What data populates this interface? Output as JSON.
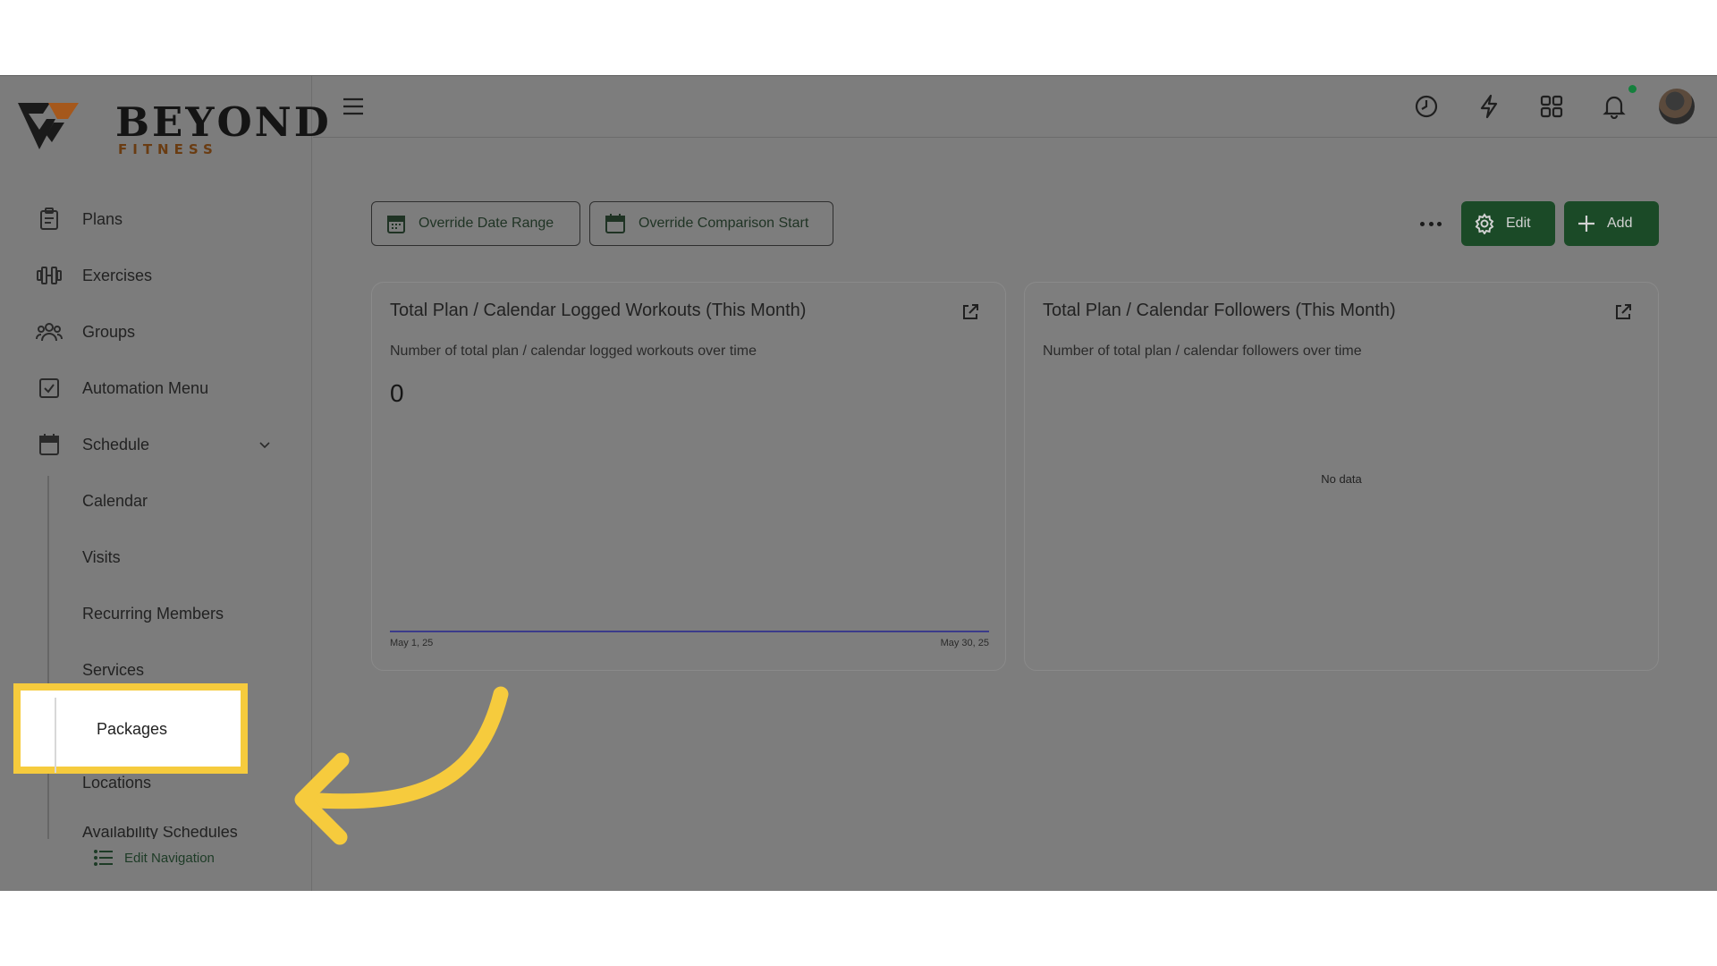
{
  "brand": {
    "name": "BEYOND",
    "tagline": "FITNESS"
  },
  "sidebar": {
    "items": [
      {
        "label": "Plans",
        "icon": "clipboard-icon"
      },
      {
        "label": "Exercises",
        "icon": "dumbbell-icon"
      },
      {
        "label": "Groups",
        "icon": "users-icon"
      },
      {
        "label": "Automation Menu",
        "icon": "checkbox-icon"
      },
      {
        "label": "Schedule",
        "icon": "calendar-icon"
      }
    ],
    "schedule_sub": [
      {
        "label": "Calendar"
      },
      {
        "label": "Visits"
      },
      {
        "label": "Recurring Members"
      },
      {
        "label": "Services"
      },
      {
        "label": "Packages"
      },
      {
        "label": "Locations"
      },
      {
        "label": "Availability Schedules"
      }
    ],
    "edit_navigation": "Edit Navigation"
  },
  "topbar": {
    "icons": [
      "menu-icon",
      "clock-icon",
      "lightning-icon",
      "apps-grid-icon",
      "bell-icon"
    ]
  },
  "toolbar": {
    "override_date_range": "Override Date Range",
    "override_comparison_start": "Override Comparison Start",
    "edit_label": "Edit",
    "add_label": "Add"
  },
  "cards": [
    {
      "title": "Total Plan / Calendar Logged Workouts (This Month)",
      "subtitle": "Number of total plan / calendar logged workouts over time",
      "metric": "0",
      "x_start": "May 1, 25",
      "x_end": "May 30, 25"
    },
    {
      "title": "Total Plan / Calendar Followers (This Month)",
      "subtitle": "Number of total plan / calendar followers over time",
      "empty_text": "No data"
    }
  ],
  "colors": {
    "accent_green": "#1b4a27",
    "highlight": "#f6cb3d",
    "notification": "#15803d",
    "chart_line": "#3b3b8a"
  }
}
